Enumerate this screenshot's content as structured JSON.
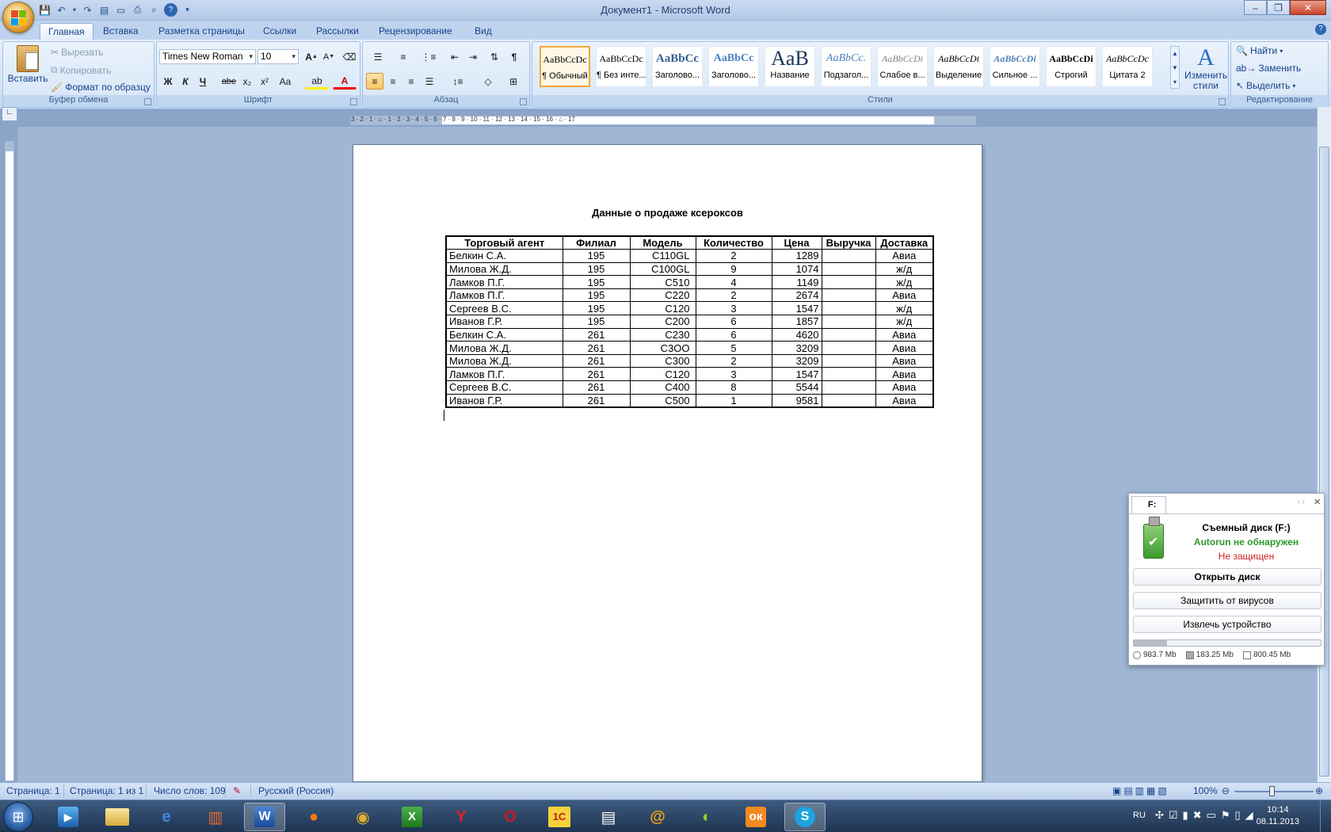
{
  "window": {
    "title": "Документ1 - Microsoft Word"
  },
  "tabs": [
    "Главная",
    "Вставка",
    "Разметка страницы",
    "Ссылки",
    "Рассылки",
    "Рецензирование",
    "Вид"
  ],
  "ribbon": {
    "clipboard": {
      "label": "Буфер обмена",
      "paste": "Вставить",
      "cut": "Вырезать",
      "copy": "Копировать",
      "format_painter": "Формат по образцу"
    },
    "font": {
      "label": "Шрифт",
      "family": "Times New Roman",
      "size": "10",
      "bold": "Ж",
      "italic": "К",
      "underline": "Ч",
      "strike": "abe",
      "sub": "x₂",
      "sup": "x²",
      "case": "Aa"
    },
    "paragraph": {
      "label": "Абзац"
    },
    "styles": {
      "label": "Стили",
      "change": "Изменить стили",
      "items": [
        {
          "sample": "AaBbCcDc",
          "name": "¶ Обычный"
        },
        {
          "sample": "AaBbCcDc",
          "name": "¶ Без инте..."
        },
        {
          "sample": "AaBbCc",
          "name": "Заголово..."
        },
        {
          "sample": "AaBbCc",
          "name": "Заголово..."
        },
        {
          "sample": "AaB",
          "name": "Название"
        },
        {
          "sample": "AaBbCc.",
          "name": "Подзагол..."
        },
        {
          "sample": "AaBbCcDi",
          "name": "Слабое в..."
        },
        {
          "sample": "AaBbCcDi",
          "name": "Выделение"
        },
        {
          "sample": "AaBbCcDi",
          "name": "Сильное ..."
        },
        {
          "sample": "AaBbCcDi",
          "name": "Строгий"
        },
        {
          "sample": "AaBbCcDc",
          "name": "Цитата 2"
        }
      ]
    },
    "editing": {
      "label": "Редактирование",
      "find": "Найти",
      "replace": "Заменить",
      "select": "Выделить"
    }
  },
  "ruler": {
    "h_numbers": "3 · 2 · 1 · ⌂ · 1 · 2 · 3 · 4 · 5 · 6 · 7 · 8 · 9 · 10 · 11 · 12 · 13 · 14 · 15 · 16 · ⌂ · 17"
  },
  "document": {
    "title": "Данные о продаже ксероксов",
    "headers": [
      "Торговый агент",
      "Филиал",
      "Модель",
      "Количество",
      "Цена",
      "Выручка",
      "Доставка"
    ],
    "rows": [
      [
        "Белкин С.А.",
        "195",
        "С110GL",
        "2",
        "1289",
        "",
        "Авиа"
      ],
      [
        "Милова Ж.Д.",
        "195",
        "С100GL",
        "9",
        "1074",
        "",
        "ж/д"
      ],
      [
        "Ламков П.Г.",
        "195",
        "С510",
        "4",
        "1149",
        "",
        "ж/д"
      ],
      [
        "Ламков П.Г.",
        "195",
        "С220",
        "2",
        "2674",
        "",
        "Авиа"
      ],
      [
        "Сергеев В.С.",
        "195",
        "С120",
        "3",
        "1547",
        "",
        "ж/д"
      ],
      [
        "Иванов Г.Р.",
        "195",
        "С200",
        "6",
        "1857",
        "",
        "ж/д"
      ],
      [
        "Белкин С.А.",
        "261",
        "С230",
        "6",
        "4620",
        "",
        "Авиа"
      ],
      [
        "Милова Ж.Д.",
        "261",
        "С3ОО",
        "5",
        "3209",
        "",
        "Авиа"
      ],
      [
        "Милова Ж.Д.",
        "261",
        "С300",
        "2",
        "3209",
        "",
        "Авиа"
      ],
      [
        "Ламков П.Г.",
        "261",
        "С120",
        "3",
        "1547",
        "",
        "Авиа"
      ],
      [
        "Сергеев В.С.",
        "261",
        "С400",
        "8",
        "5544",
        "",
        "Авиа"
      ],
      [
        "Иванов Г.Р.",
        "261",
        "С500",
        "1",
        "9581",
        "",
        "Авиа"
      ]
    ]
  },
  "statusbar": {
    "page": "Страница: 1",
    "pages": "Страница: 1 из 1",
    "words": "Число слов: 109",
    "language": "Русский (Россия)",
    "zoom": "100%"
  },
  "popup": {
    "tab": "F:",
    "drive": "Съемный диск  (F:)",
    "autorun": "Autorun не обнаружен",
    "status": "Не защищен",
    "open_btn": "Открыть диск",
    "protect_btn": "Защитить от вирусов",
    "eject_btn": "Извлечь устройство",
    "stat1": "983.7 Mb",
    "stat2": "183.25 Mb",
    "stat3": "800.45 Mb"
  },
  "tray": {
    "lang": "RU",
    "time": "10:14",
    "date": "08.11.2013"
  }
}
